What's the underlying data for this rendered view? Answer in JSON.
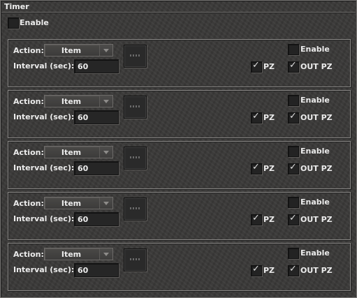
{
  "window": {
    "title": "Timer"
  },
  "global_enable": {
    "label": "Enable",
    "checked": false
  },
  "timers": [
    {
      "action_label": "Action:",
      "action_value": "Item",
      "interval_label": "Interval (sec):",
      "interval_value": "60",
      "enable_label": "Enable",
      "enable_checked": false,
      "pz_label": "PZ",
      "pz_checked": true,
      "out_pz_label": "OUT PZ",
      "out_pz_checked": true
    },
    {
      "action_label": "Action:",
      "action_value": "Item",
      "interval_label": "Interval (sec):",
      "interval_value": "60",
      "enable_label": "Enable",
      "enable_checked": false,
      "pz_label": "PZ",
      "pz_checked": true,
      "out_pz_label": "OUT PZ",
      "out_pz_checked": true
    },
    {
      "action_label": "Action:",
      "action_value": "Item",
      "interval_label": "Interval (sec):",
      "interval_value": "60",
      "enable_label": "Enable",
      "enable_checked": false,
      "pz_label": "PZ",
      "pz_checked": true,
      "out_pz_label": "OUT PZ",
      "out_pz_checked": true
    },
    {
      "action_label": "Action:",
      "action_value": "Item",
      "interval_label": "Interval (sec):",
      "interval_value": "60",
      "enable_label": "Enable",
      "enable_checked": false,
      "pz_label": "PZ",
      "pz_checked": true,
      "out_pz_label": "OUT PZ",
      "out_pz_checked": true
    },
    {
      "action_label": "Action:",
      "action_value": "Item",
      "interval_label": "Interval (sec):",
      "interval_value": "60",
      "enable_label": "Enable",
      "enable_checked": false,
      "pz_label": "PZ",
      "pz_checked": true,
      "out_pz_label": "OUT PZ",
      "out_pz_checked": true
    }
  ],
  "icons": {
    "dropdown_arrow": "chevron-down-icon",
    "check": "check-icon",
    "item_slot": "item-slot-icon"
  },
  "colors": {
    "background": "#3a3938",
    "border": "#8a8886",
    "text": "#ececec",
    "field": "#262626"
  }
}
